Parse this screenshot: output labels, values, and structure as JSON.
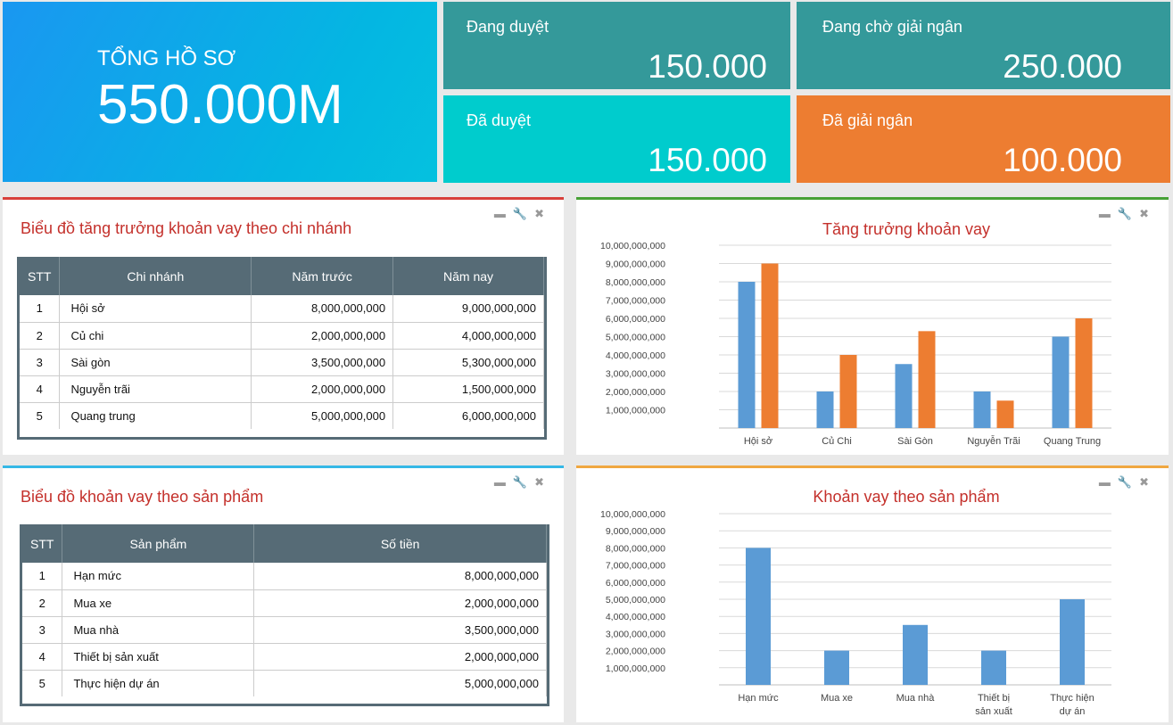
{
  "tiles": {
    "total": {
      "label": "TỔNG HỒ SƠ",
      "value": "550.000M"
    },
    "reviewing": {
      "label": "Đang duyệt",
      "value": "150.000"
    },
    "pending_disbursement": {
      "label": "Đang chờ giải ngân",
      "value": "250.000"
    },
    "approved": {
      "label": "Đã duyệt",
      "value": "150.000"
    },
    "disbursed": {
      "label": "Đã giải ngân",
      "value": "100.000"
    }
  },
  "colors": {
    "teal": "#34999a",
    "cyan": "#00cccd",
    "orange": "#ed7d31",
    "blue": "#5b9bd5",
    "red": "#d8403b",
    "green": "#47a136",
    "lightblue": "#35b8e6",
    "amber": "#f0a740"
  },
  "branch_panel": {
    "title": "Biểu đồ tăng trưởng khoản vay theo chi nhánh",
    "headers": [
      "STT",
      "Chi nhánh",
      "Năm trước",
      "Năm nay"
    ],
    "rows": [
      [
        "1",
        "Hội sở",
        "8,000,000,000",
        "9,000,000,000"
      ],
      [
        "2",
        "Củ chi",
        "2,000,000,000",
        "4,000,000,000"
      ],
      [
        "3",
        "Sài gòn",
        "3,500,000,000",
        "5,300,000,000"
      ],
      [
        "4",
        "Nguyễn trãi",
        "2,000,000,000",
        "1,500,000,000"
      ],
      [
        "5",
        "Quang trung",
        "5,000,000,000",
        "6,000,000,000"
      ]
    ]
  },
  "product_panel": {
    "title": "Biểu đồ khoản vay theo sản phẩm",
    "headers": [
      "STT",
      "Sản phẩm",
      "Số tiền"
    ],
    "rows": [
      [
        "1",
        "Hạn mức",
        "8,000,000,000"
      ],
      [
        "2",
        "Mua xe",
        "2,000,000,000"
      ],
      [
        "3",
        "Mua nhà",
        "3,500,000,000"
      ],
      [
        "4",
        "Thiết bị sản xuất",
        "2,000,000,000"
      ],
      [
        "5",
        "Thực hiện dự án",
        "5,000,000,000"
      ]
    ]
  },
  "chart_data": [
    {
      "type": "bar",
      "title": "Tăng trưởng khoản vay",
      "categories": [
        "Hội sở",
        "Củ Chi",
        "Sài Gòn",
        "Nguyễn Trãi",
        "Quang Trung"
      ],
      "series": [
        {
          "values": [
            8000000000,
            2000000000,
            3500000000,
            2000000000,
            5000000000
          ],
          "color": "#5b9bd5"
        },
        {
          "values": [
            9000000000,
            4000000000,
            5300000000,
            1500000000,
            6000000000
          ],
          "color": "#ed7d31"
        }
      ],
      "yticks": [
        "10,000,000,000",
        "9,000,000,000",
        "8,000,000,000",
        "7,000,000,000",
        "6,000,000,000",
        "5,000,000,000",
        "4,000,000,000",
        "3,000,000,000",
        "2,000,000,000",
        "1,000,000,000"
      ],
      "ylim": [
        0,
        10000000000
      ],
      "grid": true
    },
    {
      "type": "bar",
      "title": "Khoản vay theo sản phẩm",
      "categories": [
        "Hạn mức",
        "Mua xe",
        "Mua nhà",
        "Thiết bị sản xuất",
        "Thực hiện dự án"
      ],
      "series": [
        {
          "values": [
            8000000000,
            2000000000,
            3500000000,
            2000000000,
            5000000000
          ],
          "color": "#5b9bd5"
        }
      ],
      "yticks": [
        "10,000,000,000",
        "9,000,000,000",
        "8,000,000,000",
        "7,000,000,000",
        "6,000,000,000",
        "5,000,000,000",
        "4,000,000,000",
        "3,000,000,000",
        "2,000,000,000",
        "1,000,000,000"
      ],
      "ylim": [
        0,
        10000000000
      ],
      "grid": true
    }
  ],
  "tool_icons": [
    "minimize-icon",
    "wrench-icon",
    "close-icon"
  ]
}
